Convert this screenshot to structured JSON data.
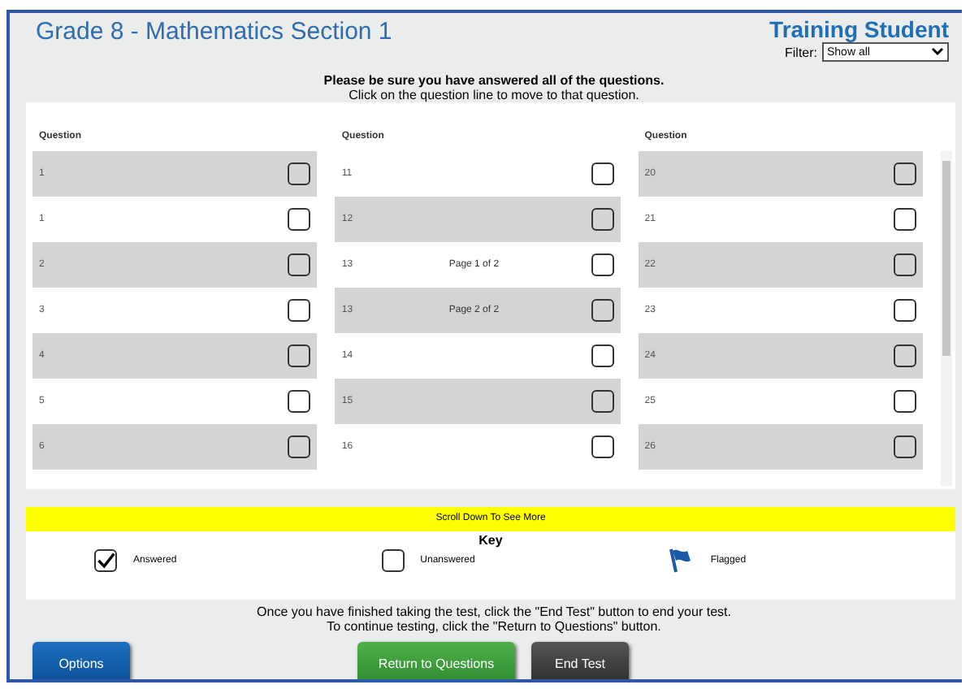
{
  "header": {
    "title": "Grade 8 - Mathematics Section 1",
    "student": "Training Student",
    "filter": {
      "label": "Filter:",
      "value": "Show all"
    }
  },
  "instructions": [
    "Please be sure you have answered all of the questions.",
    "Click on the question line to move to that question."
  ],
  "columns": [
    {
      "heading": "Question",
      "rows": [
        {
          "number": "1",
          "checked": false
        },
        {
          "number": "1",
          "checked": false
        },
        {
          "number": "2",
          "checked": false
        },
        {
          "number": "3",
          "checked": false
        },
        {
          "number": "4",
          "checked": false
        },
        {
          "number": "5",
          "checked": false
        },
        {
          "number": "6",
          "checked": false
        }
      ]
    },
    {
      "heading": "Question",
      "rows": [
        {
          "number": "11",
          "checked": false
        },
        {
          "number": "12",
          "checked": false
        },
        {
          "number": "13",
          "note": "Page 1 of 2",
          "checked": false
        },
        {
          "number": "13",
          "note": "Page 2 of 2",
          "checked": false
        },
        {
          "number": "14",
          "checked": false
        },
        {
          "number": "15",
          "checked": false
        },
        {
          "number": "16",
          "checked": false
        }
      ]
    },
    {
      "heading": "Question",
      "rows": [
        {
          "number": "20",
          "checked": false
        },
        {
          "number": "21",
          "checked": false
        },
        {
          "number": "22",
          "checked": false
        },
        {
          "number": "23",
          "checked": false
        },
        {
          "number": "24",
          "checked": false
        },
        {
          "number": "25",
          "checked": false
        },
        {
          "number": "26",
          "checked": false
        }
      ]
    }
  ],
  "scroll_hint": "Scroll Down To See More",
  "key": {
    "title": "Key",
    "items": [
      {
        "kind": "answered",
        "label": "Answered"
      },
      {
        "kind": "unanswered",
        "label": "Unanswered"
      },
      {
        "kind": "flagged",
        "label": "Flagged"
      }
    ]
  },
  "footer_text": [
    "Once you have finished taking the test, click the \"End Test\" button to end your test.",
    "To continue testing, click the \"Return to Questions\" button."
  ],
  "buttons": [
    {
      "kind": "options",
      "label": "Options"
    },
    {
      "kind": "return",
      "label": "Return to Questions"
    },
    {
      "kind": "end",
      "label": "End Test"
    }
  ]
}
